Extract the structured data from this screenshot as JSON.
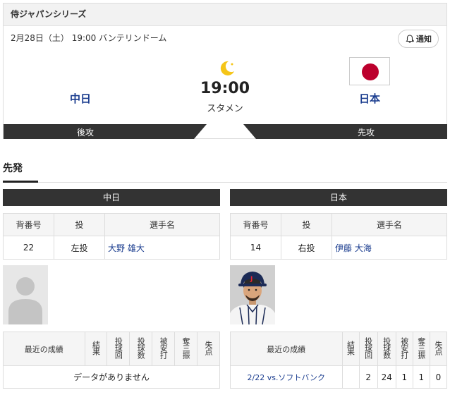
{
  "header": {
    "series": "侍ジャパンシリーズ",
    "meta": "2月28日（土） 19:00 バンテリンドーム",
    "notify_label": "通知"
  },
  "game": {
    "home_team": "中日",
    "away_team": "日本",
    "time": "19:00",
    "status": "スタメン",
    "home_bat": "後攻",
    "away_bat": "先攻"
  },
  "section": {
    "title": "先発"
  },
  "teams": {
    "left": {
      "name": "中日",
      "pitch_headers": [
        "背番号",
        "投",
        "選手名"
      ],
      "pitcher": {
        "number": "22",
        "throws": "左投",
        "name": "大野 雄大"
      },
      "stats_headers": [
        "最近の成績",
        "結果",
        "投球回",
        "投球数",
        "被安打",
        "奪三振",
        "失点"
      ],
      "no_data": "データがありません"
    },
    "right": {
      "name": "日本",
      "pitch_headers": [
        "背番号",
        "投",
        "選手名"
      ],
      "pitcher": {
        "number": "14",
        "throws": "右投",
        "name": "伊藤 大海"
      },
      "stats_headers": [
        "最近の成績",
        "結果",
        "投球回",
        "投球数",
        "被安打",
        "奪三振",
        "失点"
      ],
      "recent": {
        "game": "2/22 vs.ソフトバンク",
        "result": "",
        "innings": "2",
        "pitches": "24",
        "hits": "1",
        "strikeouts": "1",
        "runs": "0"
      }
    }
  },
  "colors": {
    "accent_blue": "#1b3d8f",
    "dark_bar": "#333333",
    "japan_red": "#bc002d",
    "moon_yellow": "#f5c518"
  }
}
